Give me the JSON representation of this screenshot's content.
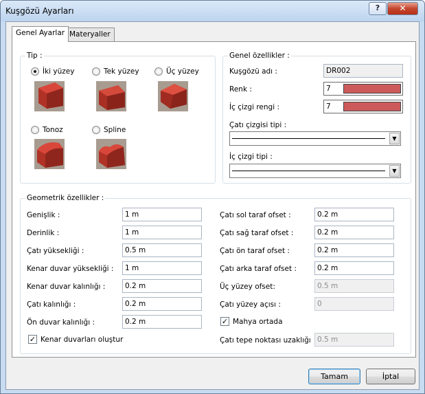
{
  "window": {
    "title": "Kuşgözü Ayarları",
    "help_label": "?",
    "close_label": "✕"
  },
  "tabs": [
    "Genel Ayarlar",
    "Materyaller"
  ],
  "tip": {
    "title": "Tip :",
    "options": [
      {
        "label": "İki yüzey",
        "selected": true
      },
      {
        "label": "Tek yüzey",
        "selected": false
      },
      {
        "label": "Üç yüzey",
        "selected": false
      },
      {
        "label": "Tonoz",
        "selected": false
      },
      {
        "label": "Spline",
        "selected": false
      }
    ]
  },
  "genel": {
    "title": "Genel özellikler :",
    "name_label": "Kuşgözü adı :",
    "name_value": "DR002",
    "renk_label": "Renk :",
    "renk_value": "7",
    "ic_renk_label": "İç çizgi rengi :",
    "ic_renk_value": "7",
    "swatch_color": "#cd5a5a",
    "cati_cizgi_label": "Çatı çizgisi tipi :",
    "ic_cizgi_label": "İç çizgi tipi :"
  },
  "geo": {
    "title": "Geometrik özellikler :",
    "left": [
      {
        "label": "Genişlik :",
        "value": "1 m"
      },
      {
        "label": "Derinlik :",
        "value": "1 m"
      },
      {
        "label": "Çatı yüksekliği :",
        "value": "0.5 m"
      },
      {
        "label": "Kenar duvar yüksekliği :",
        "value": "1 m"
      },
      {
        "label": "Kenar duvar kalınlığı :",
        "value": "0.2 m"
      },
      {
        "label": "Çatı kalınlığı :",
        "value": "0.2 m"
      },
      {
        "label": "Ön duvar kalınlığı :",
        "value": "0.2 m"
      }
    ],
    "right": [
      {
        "label": "Çatı sol taraf ofset :",
        "value": "0.2 m",
        "disabled": false
      },
      {
        "label": "Çatı sağ taraf ofset :",
        "value": "0.2 m",
        "disabled": false
      },
      {
        "label": "Çatı ön taraf ofset :",
        "value": "0.2 m",
        "disabled": false
      },
      {
        "label": "Çatı arka taraf ofset :",
        "value": "0.2 m",
        "disabled": false
      },
      {
        "label": "Üç yüzey ofset:",
        "value": "0.5 m",
        "disabled": true
      },
      {
        "label": "Çatı yüzey açısı :",
        "value": "0",
        "disabled": true
      }
    ],
    "mahya_label": "Mahya ortada",
    "mahya_checked": true,
    "tepe_label": "Çatı tepe noktası uzaklığı",
    "tepe_value": "0.5 m",
    "kenar_label": "Kenar duvarları oluştur",
    "kenar_checked": true
  },
  "buttons": {
    "ok": "Tamam",
    "cancel": "İptal"
  }
}
